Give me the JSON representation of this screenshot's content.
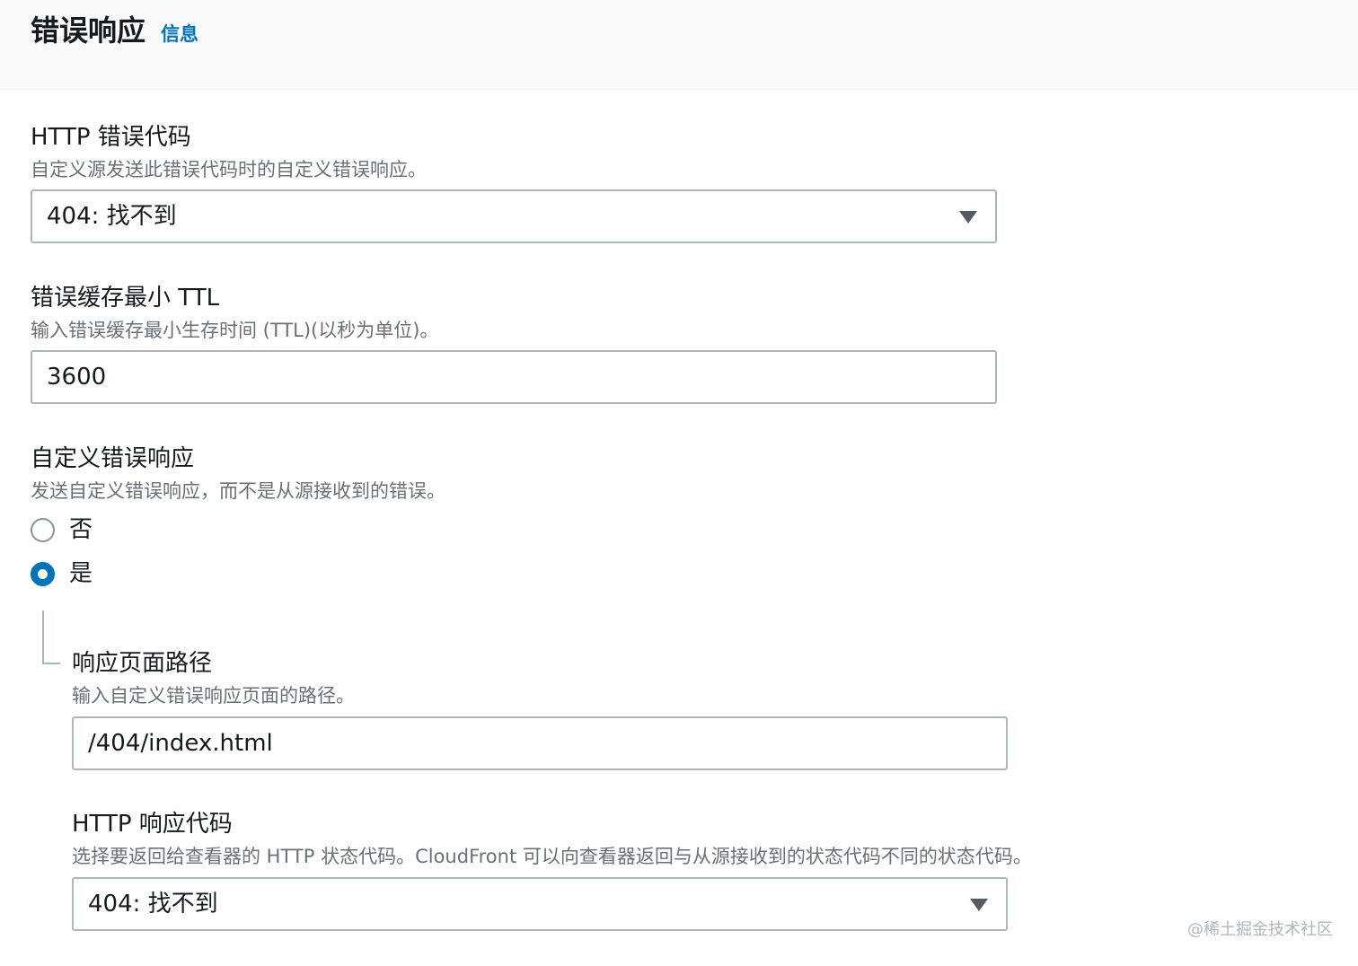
{
  "header": {
    "title": "错误响应",
    "info_link": "信息"
  },
  "http_error_code": {
    "label": "HTTP 错误代码",
    "description": "自定义源发送此错误代码时的自定义错误响应。",
    "selected": "404: 找不到"
  },
  "error_cache_min_ttl": {
    "label": "错误缓存最小 TTL",
    "description": "输入错误缓存最小生存时间 (TTL)(以秒为单位)。",
    "value": "3600"
  },
  "custom_error_response": {
    "label": "自定义错误响应",
    "description": "发送自定义错误响应，而不是从源接收到的错误。",
    "options": [
      {
        "label": "否",
        "selected": false
      },
      {
        "label": "是",
        "selected": true
      }
    ]
  },
  "response_page_path": {
    "label": "响应页面路径",
    "description": "输入自定义错误响应页面的路径。",
    "value": "/404/index.html"
  },
  "http_response_code": {
    "label": "HTTP 响应代码",
    "description": "选择要返回给查看器的 HTTP 状态代码。CloudFront 可以向查看器返回与从源接收到的状态代码不同的状态代码。",
    "selected": "404: 找不到"
  },
  "watermark": "@稀土掘金技术社区",
  "colors": {
    "accent": "#0073bb",
    "border": "#aab7b8",
    "description_text": "#687078",
    "header_bg": "#fafafa"
  }
}
